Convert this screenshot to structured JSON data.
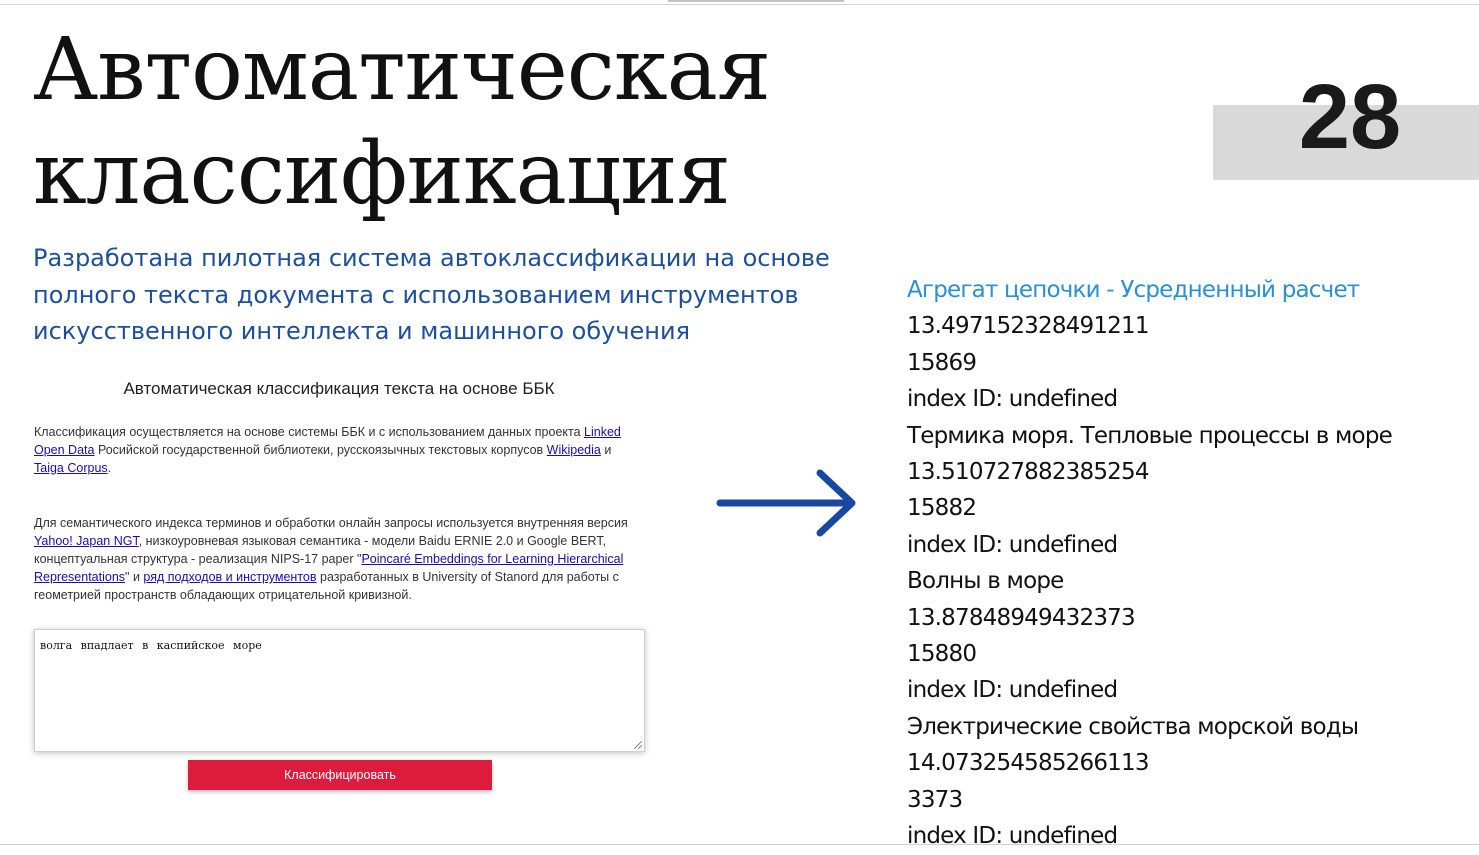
{
  "slide": {
    "title_lines": [
      "Автоматическая",
      "классификация"
    ],
    "page_number": "28",
    "subtitle": "Разработана пилотная система автоклассификации на основе полного текста документа с использованием инструментов искусственного интеллекта и машинного обучения"
  },
  "app": {
    "heading": "Автоматическая классификация текста на основе ББК",
    "para1": {
      "t1": "Классификация осуществляется на основе системы ББК и с использованием данных проекта ",
      "link_lod": "Linked Open Data",
      "t2": " Росийской государственной библиотеки, русскоязычных текстовых корпусов ",
      "link_wikipedia": "Wikipedia",
      "t3": " и ",
      "link_taiga": "Taiga Corpus",
      "t4": "."
    },
    "para2": {
      "t1": "Для семантического индекса терминов и обработки онлайн запросы используется внутренняя версия ",
      "link_ngt": "Yahoo! Japan NGT",
      "t2": ", низкоуровневая языковая семантика - модели Baidu ERNIE 2.0 и Google BERT, концептуальная структура - реализация NIPS-17 paper \"",
      "link_poincare": "Poincaré Embeddings for Learning Hierarchical Representations",
      "t3": "\" и ",
      "link_approaches": "ряд подходов и инструментов",
      "t4": " разработанных в University of Stanord для работы с геометрией пространств обладающих отрицательной кривизной."
    },
    "query_text": "волга впадлает в каспийское море",
    "classify_button": "Классифицировать"
  },
  "results": {
    "title": "Агрегат цепочки - Усредненный расчет",
    "lines": [
      "13.497152328491211",
      "15869",
      "index ID: undefined",
      "Термика моря. Тепловые процессы в море",
      "13.510727882385254",
      "15882",
      "index ID: undefined",
      "Волны в море",
      "13.87848949432373",
      "15880",
      "index ID: undefined",
      "Электрические свойства морской воды",
      "14.073254585266113",
      "3373",
      "index ID: undefined"
    ]
  },
  "colors": {
    "subtitle": "#1d4f9c",
    "results_title": "#2b8fd6",
    "button": "#dc1b3d",
    "arrow": "#1848a0",
    "page_box": "#d9d9d9"
  },
  "icons": {
    "arrow": "arrow-right-icon",
    "resize": "resize-grip-icon"
  }
}
